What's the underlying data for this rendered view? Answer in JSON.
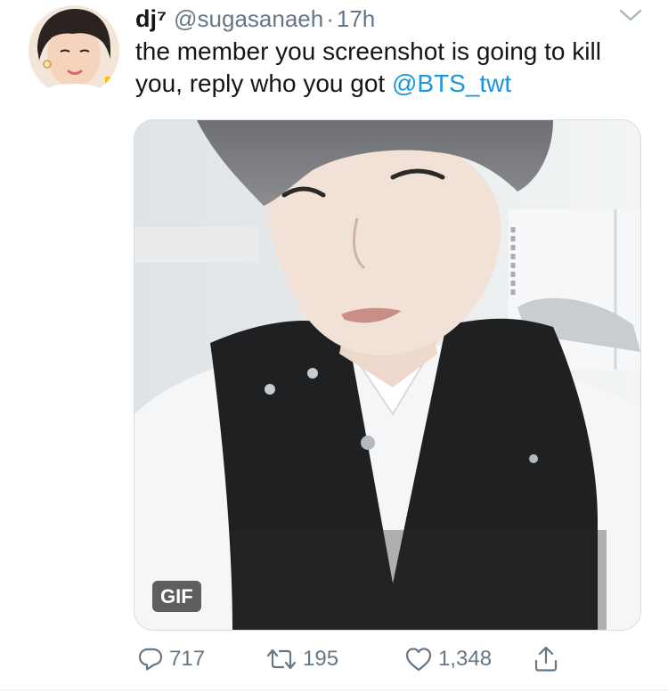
{
  "tweet": {
    "display_name": "dj⁷",
    "handle": "@sugasanaeh",
    "separator": "·",
    "time": "17h",
    "text": "the member you screenshot is going to kill you, reply who you got ",
    "mention": "@BTS_twt"
  },
  "media": {
    "badge": "GIF"
  },
  "actions": {
    "replies": "717",
    "retweets": "195",
    "likes": "1,348"
  },
  "colors": {
    "text": "#14171a",
    "secondary": "#657786",
    "link": "#1b95e0"
  },
  "icons": {
    "menu": "chevron-down-icon",
    "reply": "reply-icon",
    "retweet": "retweet-icon",
    "like": "heart-icon",
    "share": "share-icon"
  }
}
